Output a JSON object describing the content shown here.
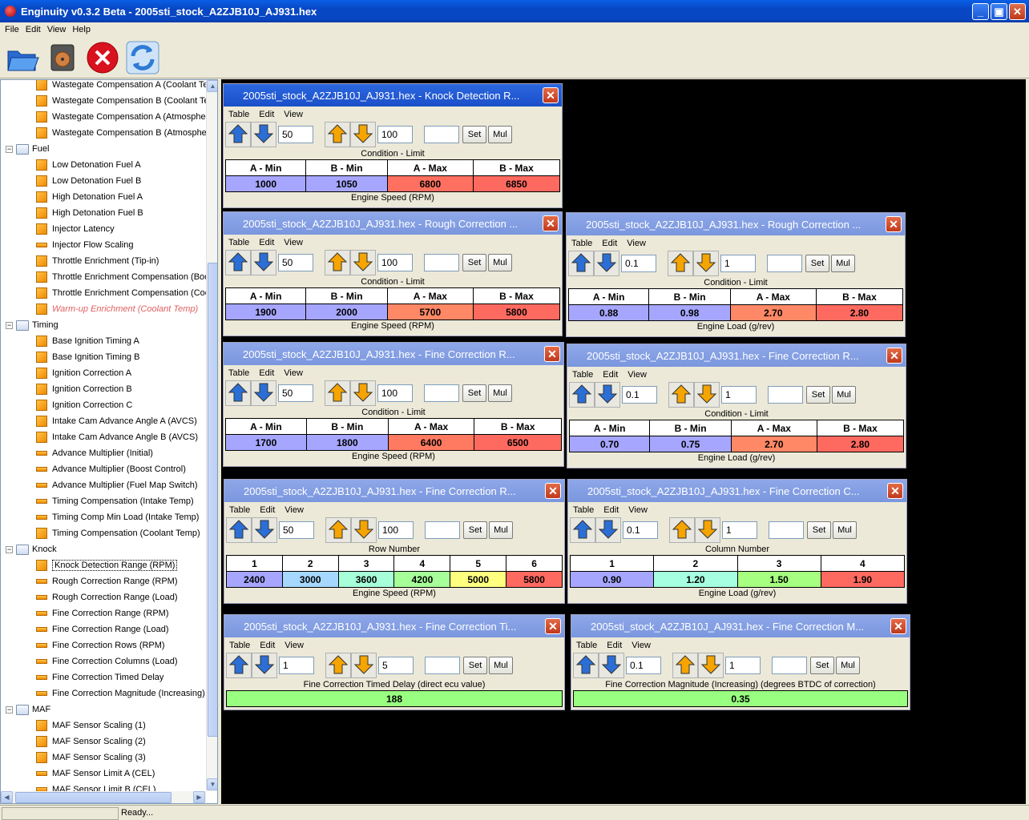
{
  "window": {
    "title": "Enginuity v0.3.2 Beta - 2005sti_stock_A2ZJB10J_AJ931.hex"
  },
  "menu": [
    "File",
    "Edit",
    "View",
    "Help"
  ],
  "toolbar": [
    "open-icon",
    "save-icon",
    "close-icon",
    "refresh-icon"
  ],
  "tree": [
    {
      "t": "table",
      "label": "Wastegate Compensation A (Coolant Te",
      "lvl": 2
    },
    {
      "t": "table",
      "label": "Wastegate Compensation B (Coolant Te",
      "lvl": 2
    },
    {
      "t": "table",
      "label": "Wastegate Compensation A (Atmospher",
      "lvl": 2
    },
    {
      "t": "table",
      "label": "Wastegate Compensation B (Atmospher",
      "lvl": 2
    },
    {
      "t": "folder",
      "label": "Fuel",
      "lvl": 1
    },
    {
      "t": "table",
      "label": "Low Detonation Fuel A",
      "lvl": 2
    },
    {
      "t": "table",
      "label": "Low Detonation Fuel B",
      "lvl": 2
    },
    {
      "t": "table",
      "label": "High Detonation Fuel A",
      "lvl": 2
    },
    {
      "t": "table",
      "label": "High Detonation Fuel B",
      "lvl": 2
    },
    {
      "t": "table",
      "label": "Injector Latency",
      "lvl": 2
    },
    {
      "t": "line",
      "label": "Injector Flow Scaling",
      "lvl": 2
    },
    {
      "t": "table",
      "label": "Throttle Enrichment (Tip-in)",
      "lvl": 2
    },
    {
      "t": "table",
      "label": "Throttle Enrichment Compensation (Boo",
      "lvl": 2
    },
    {
      "t": "table",
      "label": "Throttle Enrichment Compensation (Coo",
      "lvl": 2
    },
    {
      "t": "table",
      "label": "Warm-up Enrichment (Coolant Temp)",
      "lvl": 2,
      "red": true
    },
    {
      "t": "folder",
      "label": "Timing",
      "lvl": 1
    },
    {
      "t": "table",
      "label": "Base Ignition Timing A",
      "lvl": 2
    },
    {
      "t": "table",
      "label": "Base Ignition Timing B",
      "lvl": 2
    },
    {
      "t": "table",
      "label": "Ignition Correction A",
      "lvl": 2
    },
    {
      "t": "table",
      "label": "Ignition Correction B",
      "lvl": 2
    },
    {
      "t": "table",
      "label": "Ignition Correction C",
      "lvl": 2
    },
    {
      "t": "table",
      "label": "Intake Cam Advance Angle A (AVCS)",
      "lvl": 2
    },
    {
      "t": "table",
      "label": "Intake Cam Advance Angle B (AVCS)",
      "lvl": 2
    },
    {
      "t": "line",
      "label": "Advance Multiplier (Initial)",
      "lvl": 2
    },
    {
      "t": "line",
      "label": "Advance Multiplier (Boost Control)",
      "lvl": 2
    },
    {
      "t": "line",
      "label": "Advance Multiplier (Fuel Map Switch)",
      "lvl": 2
    },
    {
      "t": "line",
      "label": "Timing Compensation (Intake Temp)",
      "lvl": 2
    },
    {
      "t": "line",
      "label": "Timing Comp Min Load (Intake Temp)",
      "lvl": 2
    },
    {
      "t": "table",
      "label": "Timing Compensation (Coolant Temp)",
      "lvl": 2
    },
    {
      "t": "folder",
      "label": "Knock",
      "lvl": 1
    },
    {
      "t": "table",
      "label": "Knock Detection Range (RPM)",
      "lvl": 2,
      "sel": true
    },
    {
      "t": "line",
      "label": "Rough Correction Range (RPM)",
      "lvl": 2
    },
    {
      "t": "line",
      "label": "Rough Correction Range (Load)",
      "lvl": 2
    },
    {
      "t": "line",
      "label": "Fine Correction Range (RPM)",
      "lvl": 2
    },
    {
      "t": "line",
      "label": "Fine Correction Range (Load)",
      "lvl": 2
    },
    {
      "t": "line",
      "label": "Fine Correction Rows (RPM)",
      "lvl": 2
    },
    {
      "t": "line",
      "label": "Fine Correction Columns (Load)",
      "lvl": 2
    },
    {
      "t": "line",
      "label": "Fine Correction Timed Delay",
      "lvl": 2
    },
    {
      "t": "line",
      "label": "Fine Correction Magnitude (Increasing)",
      "lvl": 2
    },
    {
      "t": "folder",
      "label": "MAF",
      "lvl": 1
    },
    {
      "t": "table",
      "label": "MAF Sensor Scaling (1)",
      "lvl": 2
    },
    {
      "t": "table",
      "label": "MAF Sensor Scaling (2)",
      "lvl": 2
    },
    {
      "t": "table",
      "label": "MAF Sensor Scaling (3)",
      "lvl": 2
    },
    {
      "t": "line",
      "label": "MAF Sensor Limit A (CEL)",
      "lvl": 2
    },
    {
      "t": "line",
      "label": "MAF Sensor Limit B (CEL)",
      "lvl": 2
    }
  ],
  "tablemenu": [
    "Table",
    "Edit",
    "View"
  ],
  "set_label": "Set",
  "mul_label": "Mul",
  "windows": [
    {
      "title": "2005sti_stock_A2ZJB10J_AJ931.hex - Knock Detection R...",
      "active": true,
      "inc1": "50",
      "inc2": "100",
      "header": "Condition - Limit",
      "cols": [
        "A - Min",
        "B - Min",
        "A - Max",
        "B - Max"
      ],
      "vals": [
        "1000",
        "1050",
        "6800",
        "6850"
      ],
      "colors": [
        "#a6a6ff",
        "#a6a6ff",
        "#ff7060",
        "#ff6a60"
      ],
      "axis": "Engine Speed (RPM)"
    },
    {
      "title": "2005sti_stock_A2ZJB10J_AJ931.hex - Rough Correction ...",
      "inc1": "50",
      "inc2": "100",
      "header": "Condition - Limit",
      "cols": [
        "A - Min",
        "B - Min",
        "A - Max",
        "B - Max"
      ],
      "vals": [
        "1900",
        "2000",
        "5700",
        "5800"
      ],
      "colors": [
        "#a6a6ff",
        "#a6a6ff",
        "#ff8866",
        "#ff6a60"
      ],
      "axis": "Engine Speed (RPM)"
    },
    {
      "title": "2005sti_stock_A2ZJB10J_AJ931.hex - Rough Correction ...",
      "inc1": "0.1",
      "inc2": "1",
      "header": "Condition - Limit",
      "cols": [
        "A - Min",
        "B - Min",
        "A - Max",
        "B - Max"
      ],
      "vals": [
        "0.88",
        "0.98",
        "2.70",
        "2.80"
      ],
      "colors": [
        "#a6a6ff",
        "#a6a6ff",
        "#ff8866",
        "#ff6a60"
      ],
      "axis": "Engine Load (g/rev)"
    },
    {
      "title": "2005sti_stock_A2ZJB10J_AJ931.hex - Fine Correction R...",
      "inc1": "50",
      "inc2": "100",
      "header": "Condition - Limit",
      "cols": [
        "A - Min",
        "B - Min",
        "A - Max",
        "B - Max"
      ],
      "vals": [
        "1700",
        "1800",
        "6400",
        "6500"
      ],
      "colors": [
        "#a6a6ff",
        "#a6a6ff",
        "#ff7a60",
        "#ff6a60"
      ],
      "axis": "Engine Speed (RPM)"
    },
    {
      "title": "2005sti_stock_A2ZJB10J_AJ931.hex - Fine Correction R...",
      "inc1": "0.1",
      "inc2": "1",
      "header": "Condition - Limit",
      "cols": [
        "A - Min",
        "B - Min",
        "A - Max",
        "B - Max"
      ],
      "vals": [
        "0.70",
        "0.75",
        "2.70",
        "2.80"
      ],
      "colors": [
        "#a6a6ff",
        "#a6a6ff",
        "#ff8866",
        "#ff6a60"
      ],
      "axis": "Engine Load (g/rev)"
    },
    {
      "title": "2005sti_stock_A2ZJB10J_AJ931.hex - Fine Correction R...",
      "inc1": "50",
      "inc2": "100",
      "header": "Row Number",
      "cols": [
        "1",
        "2",
        "3",
        "4",
        "5",
        "6"
      ],
      "vals": [
        "2400",
        "3000",
        "3600",
        "4200",
        "5000",
        "5800"
      ],
      "colors": [
        "#a6a6ff",
        "#a6d8ff",
        "#a6ffd8",
        "#a6ff99",
        "#ffff80",
        "#ff6a60"
      ],
      "axis": "Engine Speed (RPM)"
    },
    {
      "title": "2005sti_stock_A2ZJB10J_AJ931.hex - Fine Correction C...",
      "inc1": "0.1",
      "inc2": "1",
      "header": "Column Number",
      "cols": [
        "1",
        "2",
        "3",
        "4"
      ],
      "vals": [
        "0.90",
        "1.20",
        "1.50",
        "1.90"
      ],
      "colors": [
        "#a6a6ff",
        "#a6ffe0",
        "#a6ff80",
        "#ff6a60"
      ],
      "axis": "Engine Load (g/rev)"
    },
    {
      "title": "2005sti_stock_A2ZJB10J_AJ931.hex - Fine Correction Ti...",
      "inc1": "1",
      "inc2": "5",
      "header": "Fine Correction Timed Delay (direct ecu value)",
      "cols": [],
      "vals": [
        "188"
      ],
      "colors": [
        "#99ff80"
      ],
      "axis": ""
    },
    {
      "title": "2005sti_stock_A2ZJB10J_AJ931.hex - Fine Correction M...",
      "inc1": "0.1",
      "inc2": "1",
      "header": "Fine Correction Magnitude (Increasing) (degrees BTDC of correction)",
      "cols": [],
      "vals": [
        "0.35"
      ],
      "colors": [
        "#99ff80"
      ],
      "axis": ""
    }
  ],
  "status": "Ready..."
}
